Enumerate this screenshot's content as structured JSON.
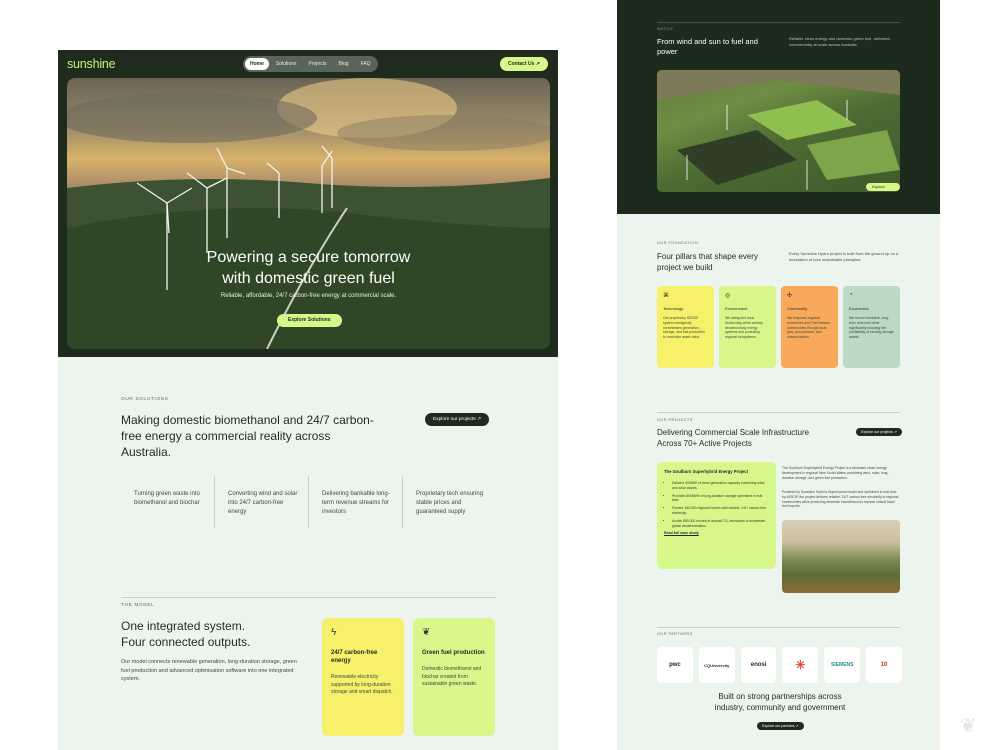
{
  "brand": {
    "logo": "sunshine",
    "accent": "#d7f78a",
    "dark": "#1e2b1d",
    "light_bg": "#ecf4ee"
  },
  "nav": {
    "items": [
      "Home",
      "Solutions",
      "Projects",
      "Blog",
      "FAQ"
    ],
    "active": "Home",
    "contact": "Contact Us ↗"
  },
  "hero": {
    "title_line1": "Powering a secure tomorrow",
    "title_line2": "with domestic green fuel",
    "subtitle": "Reliable, affordable, 24/7 carbon-free energy at commercial scale.",
    "cta": "Explore Solutions"
  },
  "solutions": {
    "eyebrow": "OUR SOLUTIONS",
    "title": "Making domestic biomethanol and 24/7 carbon-free energy a commercial reality across Australia.",
    "cta": "Explore our projects ↗",
    "features": [
      "Turning green waste into biomethanol and biochar",
      "Converting wind and solar into 24/7 carbon-free energy",
      "Delivering bankable long-term revenue streams for investors",
      "Proprietary tech ensuring stable prices and guaranteed supply"
    ]
  },
  "model": {
    "eyebrow": "THE MODEL",
    "title_line1": "One integrated system.",
    "title_line2": "Four connected outputs.",
    "text": "Our model connects renewable generation, long-duration storage, green fuel production and advanced optimisation software into one integrated system.",
    "cards": [
      {
        "icon": "lightning-icon",
        "title": "24/7 carbon-free energy",
        "text": "Renewable electricity supported by long-duration storage and smart dispatch.",
        "color": "#f6f06a"
      },
      {
        "icon": "leaf-icon",
        "title": "Green fuel production",
        "text": "Domestic biomethanol and biochar created from sustainable green waste.",
        "color": "#d7f78a"
      }
    ]
  },
  "watch": {
    "eyebrow": "WATCH",
    "title": "From wind and sun to fuel and power",
    "desc": "Reliable clean energy and domestic green fuel, delivered commercially at scale across Australia.",
    "cta": "Explore more"
  },
  "foundation": {
    "eyebrow": "OUR FOUNDATION",
    "title": "Four pillars that shape every project we build",
    "desc": "Every Sunshine Hydro project is built from the ground up on a foundation of core sustainable principles.",
    "pillars": [
      {
        "icon": "tech-icon",
        "title": "Technology",
        "text": "Our proprietary SESOP system intelligently orchestrates generation, storage, and fuel production to maximise asset value.",
        "color": "#f6f06a"
      },
      {
        "icon": "globe-icon",
        "title": "Environment",
        "text": "We safeguard local biodiversity while actively decarbonising energy systems and protecting regional ecosystems.",
        "color": "#d7f78a"
      },
      {
        "icon": "community-icon",
        "title": "Community",
        "text": "We empower regional economies and First Nations communities through local jobs, procurement, and shared returns.",
        "color": "#f8a95a"
      },
      {
        "icon": "economics-icon",
        "title": "Economics",
        "text": "We secure bankable, long-term revenues while significantly boosting the profitability of existing storage assets.",
        "color": "#bcd9c4"
      }
    ]
  },
  "projects": {
    "eyebrow": "OUR PROJECTS",
    "title": "Delivering Commercial Scale Infrastructure Across 70+ Active Projects",
    "cta": "Explore our projects ↗",
    "card_title": "The Goulburn Superhybrid Energy Project",
    "bullets": [
      "Delivers 400MW of clean generation capacity combining wind and solar assets.",
      "Provides 800MWh of long-duration storage optimised in real time.",
      "Powers 180,000 regional homes with reliable, 24/7 carbon-free electricity.",
      "Avoids 880,000 tonnes of annual CO₂ emissions to accelerate global decarbonisation."
    ],
    "link": "Read full case study",
    "side_text": "The Goulburn Superhybrid Energy Project is a landmark clean energy development in regional New South Wales combining wind, solar, long-duration storage, and green fuel production.",
    "side_text2": "Powered by Sunshine Hydro's Superhybrid model and optimised in real-time by AESOP, the project delivers reliable, 24/7 carbon-free electricity to regional communities while producing domestic biomethanol to replace critical fossil fuel imports."
  },
  "partners": {
    "eyebrow": "OUR PARTNERS",
    "logos": [
      "pwc",
      "CQUniversity",
      "enosi",
      "",
      "SIEMENS",
      "10"
    ],
    "title": "Built on strong partnerships across industry, community and government",
    "cta": "Explore our partners ↗"
  }
}
